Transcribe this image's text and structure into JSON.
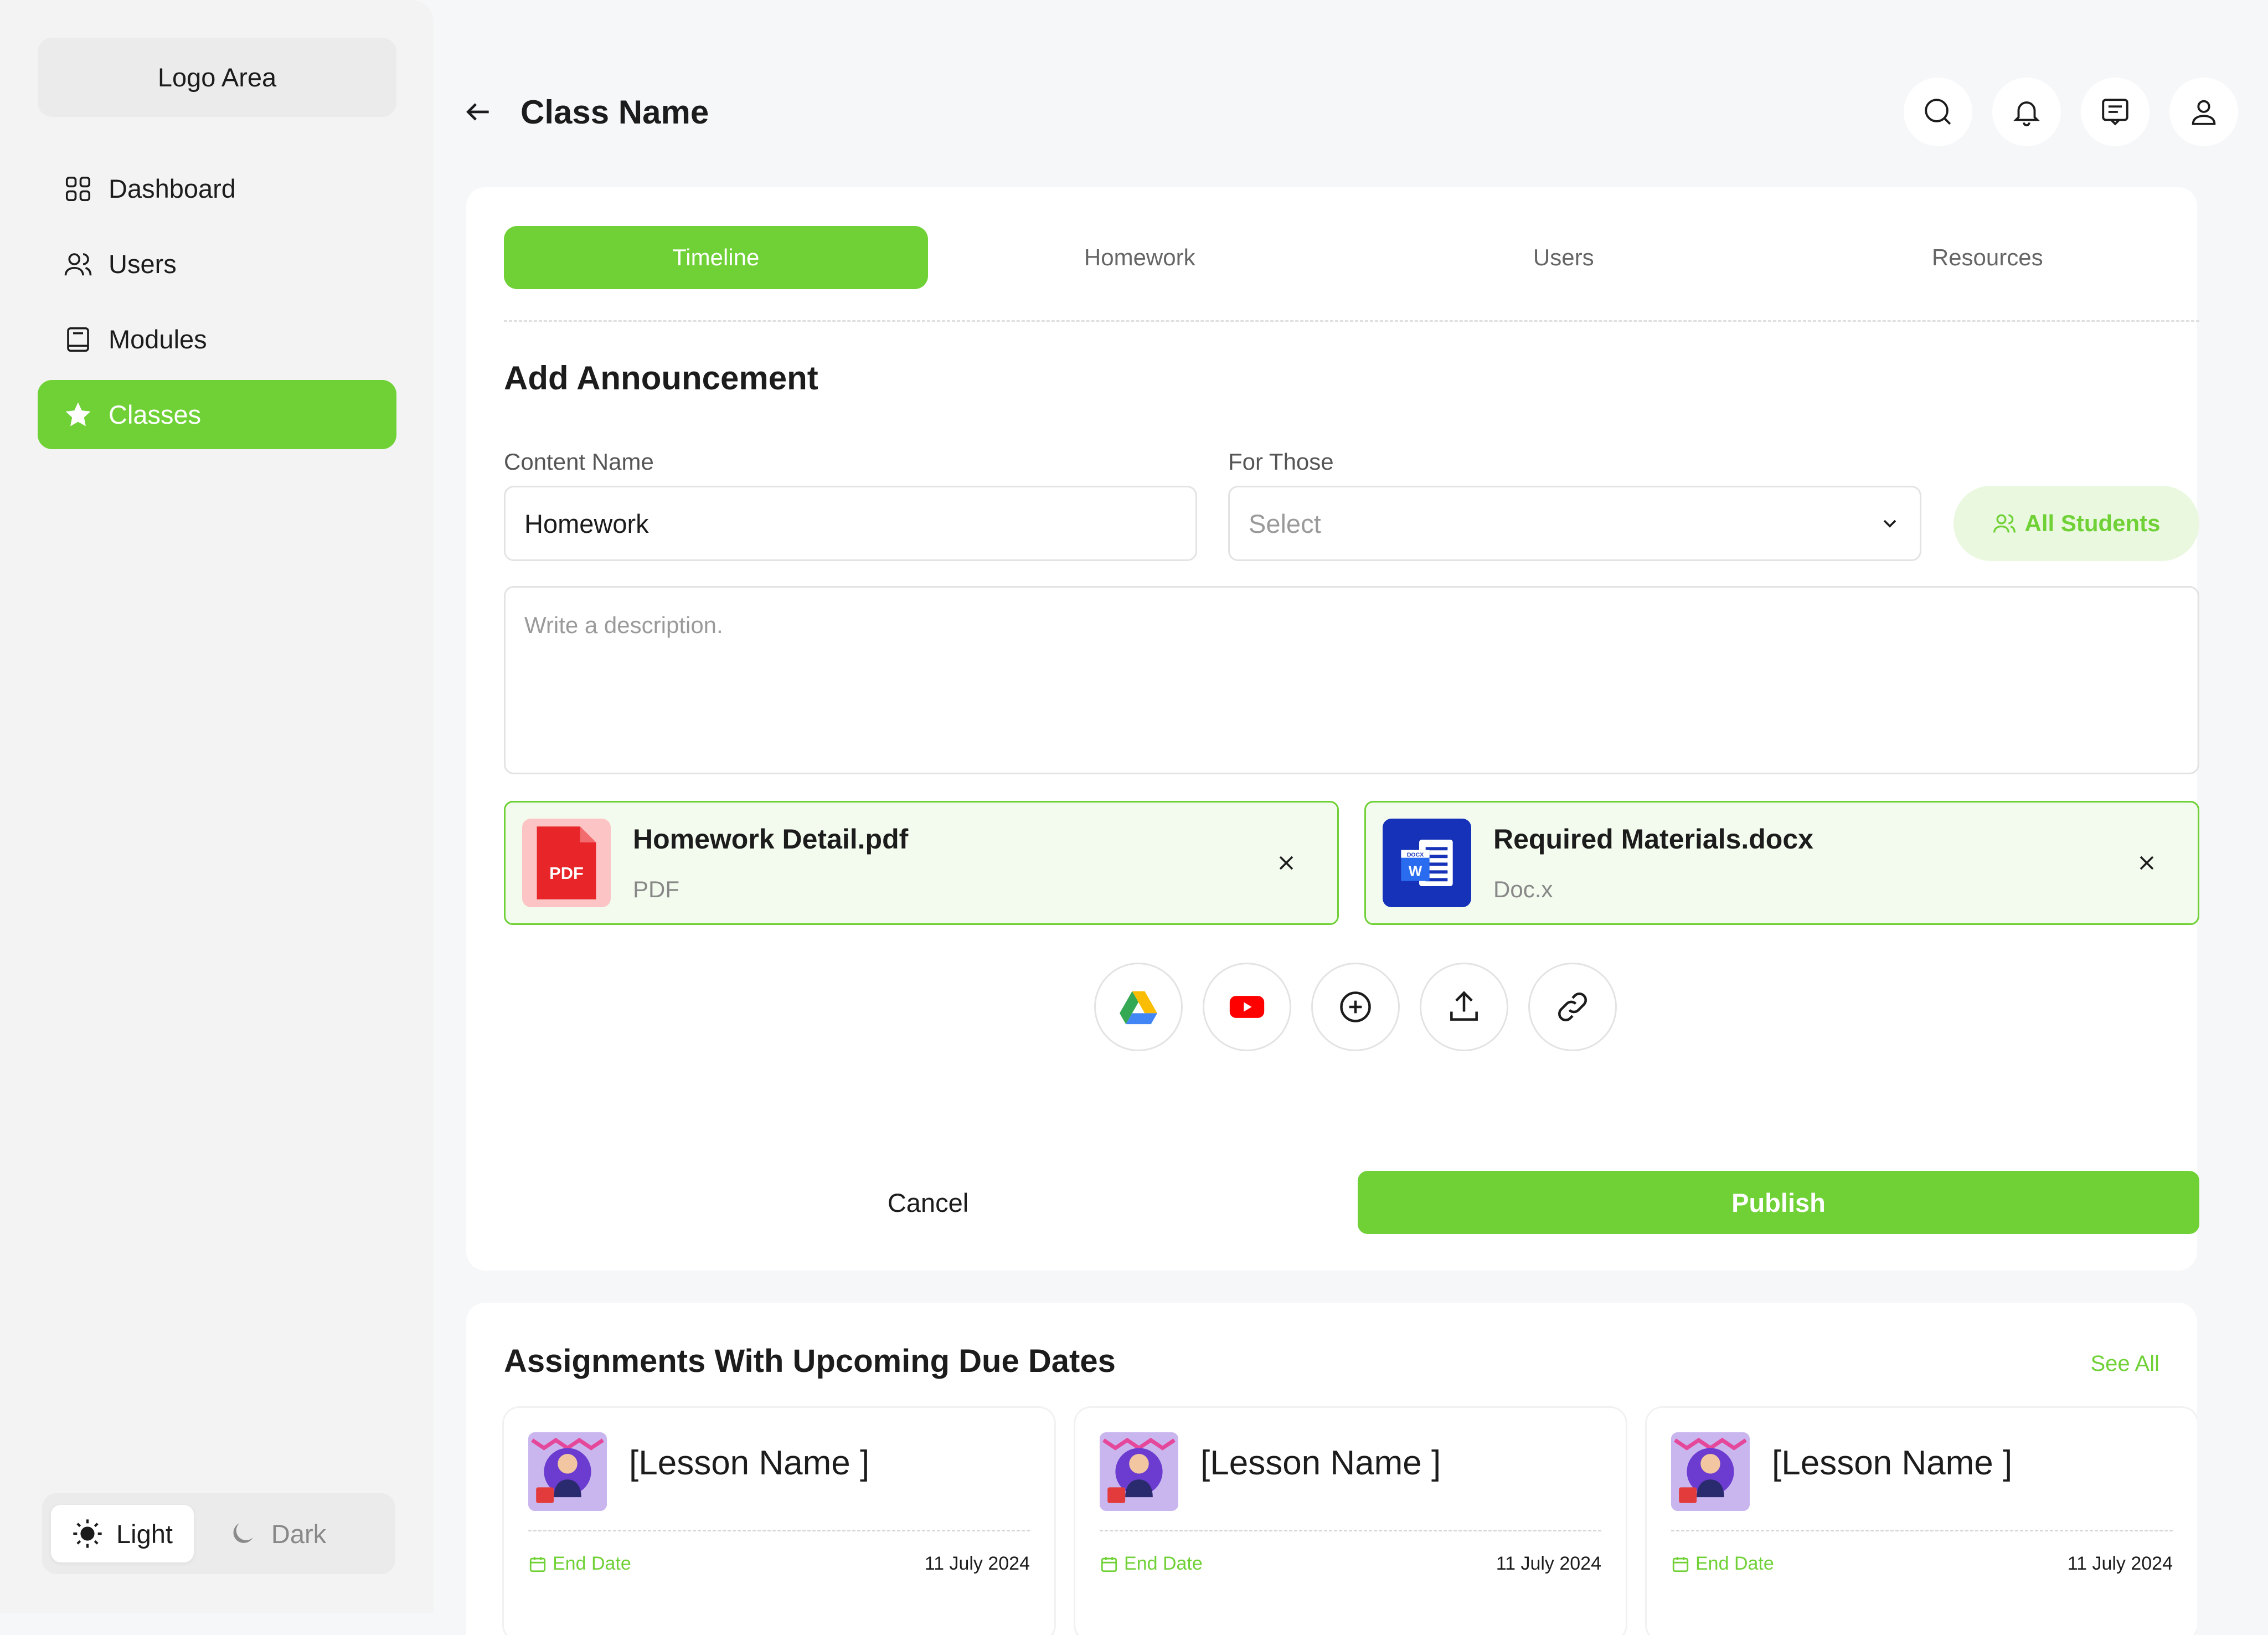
{
  "sidebar": {
    "logo": "Logo Area",
    "items": [
      {
        "label": "Dashboard",
        "icon": "grid-icon"
      },
      {
        "label": "Users",
        "icon": "users-icon"
      },
      {
        "label": "Modules",
        "icon": "book-icon"
      },
      {
        "label": "Classes",
        "icon": "star-icon",
        "active": true
      }
    ],
    "theme": {
      "light": "Light",
      "dark": "Dark",
      "selected": "Light"
    }
  },
  "header": {
    "title": "Class Name",
    "actions": [
      "search-icon",
      "bell-icon",
      "message-icon",
      "user-icon"
    ]
  },
  "tabs": [
    "Timeline",
    "Homework",
    "Users",
    "Resources"
  ],
  "active_tab": "Timeline",
  "form": {
    "title": "Add Announcement",
    "content_name_label": "Content Name",
    "content_name_value": "Homework",
    "for_those_label": "For Those",
    "for_those_placeholder": "Select",
    "audience_pill": "All Students",
    "description_placeholder": "Write a description.",
    "attachments": [
      {
        "name": "Homework Detail.pdf",
        "type": "PDF",
        "icon": "pdf-icon"
      },
      {
        "name": "Required Materials.docx",
        "type": "Doc.x",
        "icon": "docx-icon"
      }
    ],
    "pdf_badge": "PDF",
    "docx_badge": "DOCX",
    "docx_letter": "W",
    "tools": [
      "google-drive-icon",
      "youtube-icon",
      "plus-circle-icon",
      "upload-icon",
      "link-icon"
    ],
    "cancel_label": "Cancel",
    "publish_label": "Publish"
  },
  "assignments": {
    "title": "Assignments With Upcoming Due Dates",
    "see_all": "See All",
    "items": [
      {
        "name": "[Lesson Name ]",
        "date_label": "End Date",
        "date": "11 July 2024"
      },
      {
        "name": "[Lesson Name ]",
        "date_label": "End Date",
        "date": "11 July 2024"
      },
      {
        "name": "[Lesson Name ]",
        "date_label": "End Date",
        "date": "11 July 2024"
      }
    ]
  },
  "colors": {
    "accent": "#6fd136",
    "accent_light": "#eaf8df",
    "attach_bg": "#f3fbee"
  }
}
